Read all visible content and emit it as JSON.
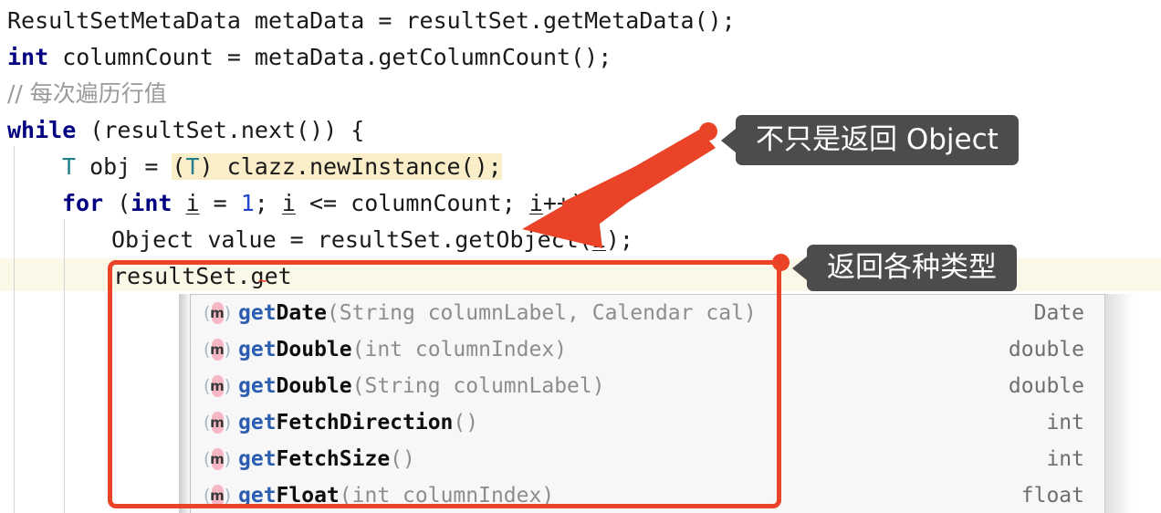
{
  "editor": {
    "font_size_px": 25,
    "lines": [
      {
        "id": "line-1",
        "text": "ResultSetMetaData metaData = resultSet.getMetaData();"
      },
      {
        "id": "line-2",
        "text": "int columnCount = metaData.getColumnCount();"
      },
      {
        "id": "line-3",
        "text": "// 每次遍历行值"
      },
      {
        "id": "line-4",
        "text": "while (resultSet.next()) {"
      },
      {
        "id": "line-5",
        "text": "    T obj = (T) clazz.newInstance();"
      },
      {
        "id": "line-6",
        "text": "    for (int i = 1; i <= columnCount; i++) {"
      },
      {
        "id": "line-7",
        "text": "        Object value = resultSet.getObject(i);"
      },
      {
        "id": "line-8",
        "text": "        resultSet.get"
      }
    ],
    "tokens": {
      "l1_a": "ResultSetMetaData metaData = resultSet.getMetaData();",
      "l2_kw": "int",
      "l2_rest": " columnCount = metaData.getColumnCount();",
      "l3_comment": "// 每次遍历行值",
      "l4_kw": "while",
      "l4_rest": " (resultSet.next()) {",
      "l5_t": "T",
      "l5_obj": " obj = ",
      "l5_cast": "(T)",
      "l5_cast_t": "T",
      "l5_tail": " clazz.newInstance();",
      "l6_for": "for",
      "l6_open": " (",
      "l6_int": "int",
      "l6_sp": " ",
      "l6_i1": "i",
      "l6_eq": " = ",
      "l6_one": "1",
      "l6_semi": "; ",
      "l6_i2": "i",
      "l6_cond": " <= columnCount; ",
      "l6_i3": "i",
      "l6_inc": "++) {",
      "l7_text": "Object value = resultSet.getObject(",
      "l7_i": "i",
      "l7_tail": ");",
      "l8_text": "resultSet.get"
    }
  },
  "completion_popup": {
    "selected_index": -1,
    "rows": [
      {
        "prefix": "get",
        "name": "Date",
        "signature": "(String columnLabel, Calendar cal)",
        "return_type": "Date",
        "icon": "method-icon",
        "icon_glyph": "m"
      },
      {
        "prefix": "get",
        "name": "Double",
        "signature": "(int columnIndex)",
        "return_type": "double",
        "icon": "method-icon",
        "icon_glyph": "m"
      },
      {
        "prefix": "get",
        "name": "Double",
        "signature": "(String columnLabel)",
        "return_type": "double",
        "icon": "method-icon",
        "icon_glyph": "m"
      },
      {
        "prefix": "get",
        "name": "FetchDirection",
        "signature": "()",
        "return_type": "int",
        "icon": "method-icon",
        "icon_glyph": "m"
      },
      {
        "prefix": "get",
        "name": "FetchSize",
        "signature": "()",
        "return_type": "int",
        "icon": "method-icon",
        "icon_glyph": "m"
      },
      {
        "prefix": "get",
        "name": "Float",
        "signature": "(int columnIndex)",
        "return_type": "float",
        "icon": "method-icon",
        "icon_glyph": "m"
      }
    ]
  },
  "annotations": {
    "callouts": [
      {
        "id": "callout-object",
        "text": "不只是返回 Object"
      },
      {
        "id": "callout-types",
        "text": "返回各种类型"
      }
    ],
    "accent_color": "#ea4327",
    "callout_bg": "#4c4c4c",
    "callout_fg": "#ffffff"
  }
}
